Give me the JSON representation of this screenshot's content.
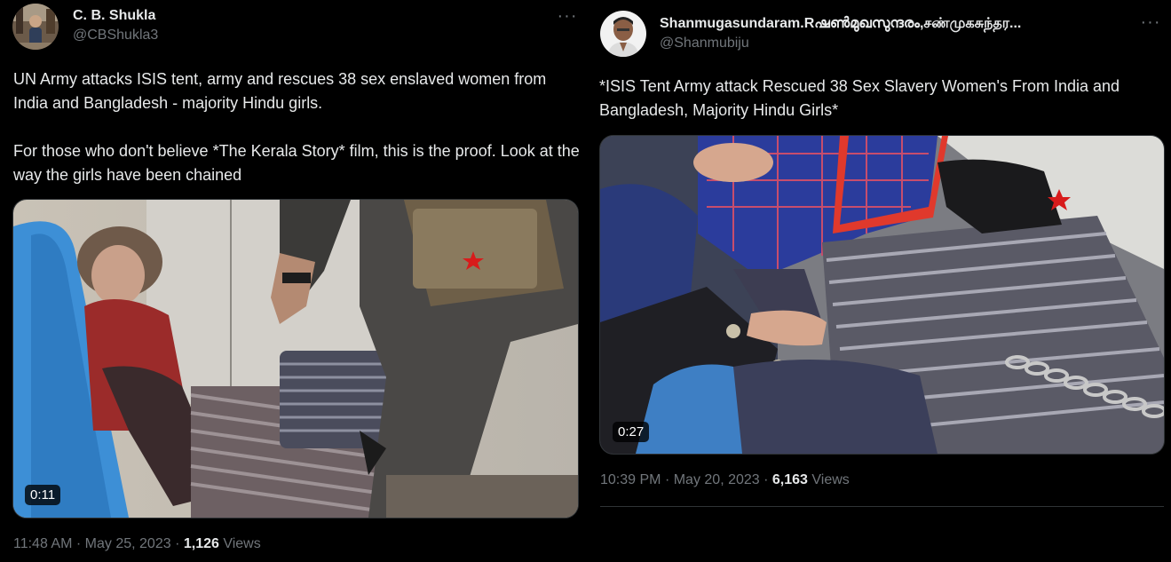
{
  "tweets": [
    {
      "name": "C. B. Shukla",
      "handle": "@CBShukla3",
      "text": [
        "UN Army attacks ISIS tent, army and rescues 38 sex enslaved women from India and Bangladesh - majority Hindu girls.",
        "For those who don't believe *The Kerala Story* film, this is the proof. Look at the way the girls have been chained"
      ],
      "video_duration": "0:11",
      "time": "11:48 AM",
      "separator": "·",
      "date": "May 25, 2023",
      "views_count": "1,126",
      "views_label": "Views",
      "more_label": "···"
    },
    {
      "name": "Shanmugasundaram.Rഷൺമുഖസുന്ദരം,சண்முகசுந்தர...",
      "handle": "@Shanmubiju",
      "text": [
        "*ISIS Tent Army attack Rescued 38 Sex Slavery Women's From India and Bangladesh, Majority Hindu Girls*"
      ],
      "video_duration": "0:27",
      "time": "10:39 PM",
      "separator": "·",
      "date": "May 20, 2023",
      "views_count": "6,163",
      "views_label": "Views",
      "more_label": "···"
    }
  ],
  "colors": {
    "background": "#000000",
    "text_primary": "#e7e9ea",
    "text_secondary": "#71767b",
    "border": "#2f3336",
    "watermark_star": "#d81b1b"
  },
  "icons": [
    "more-options-icon",
    "avatar-photo"
  ]
}
